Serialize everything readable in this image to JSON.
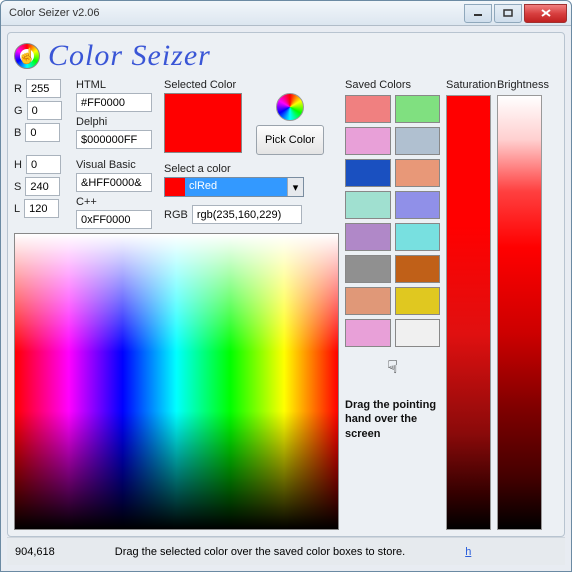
{
  "title": "Color Seizer  v2.06",
  "app_name": "Color Seizer",
  "labels": {
    "R": "R",
    "G": "G",
    "B": "B",
    "H": "H",
    "S": "S",
    "L": "L",
    "HTML": "HTML",
    "Delphi": "Delphi",
    "VB": "Visual Basic",
    "Cpp": "C++",
    "Selected": "Selected Color",
    "Pick": "Pick Color",
    "SelectA": "Select a color",
    "RGB": "RGB",
    "Saved": "Saved Colors",
    "Saturation": "Saturation",
    "Brightness": "Brightness"
  },
  "rgb": {
    "R": "255",
    "G": "0",
    "B": "0"
  },
  "hsl": {
    "H": "0",
    "S": "240",
    "L": "120"
  },
  "codes": {
    "html": "#FF0000",
    "delphi": "$000000FF",
    "vb": "&HFF0000&",
    "cpp": "0xFF0000",
    "rgb": "rgb(235,160,229)"
  },
  "combo": {
    "text": "clRed",
    "swatch": "#ff0000"
  },
  "selected_color": "#ff0000",
  "saved_colors": [
    "#f08080",
    "#80e080",
    "#e8a0d8",
    "#b0c0d0",
    "#1a50c0",
    "#e89878",
    "#a0e0d0",
    "#9090e8",
    "#b088c8",
    "#78e0e0",
    "#909090",
    "#c06018",
    "#e09878",
    "#e0c820",
    "#e8a0d8",
    "#f0f0f0"
  ],
  "hint_cursor": "☟",
  "hint_text": "Drag the pointing hand over the screen",
  "footer": {
    "coords": "904,618",
    "hint": "Drag the selected color over the saved color boxes to store.",
    "link": "h"
  }
}
